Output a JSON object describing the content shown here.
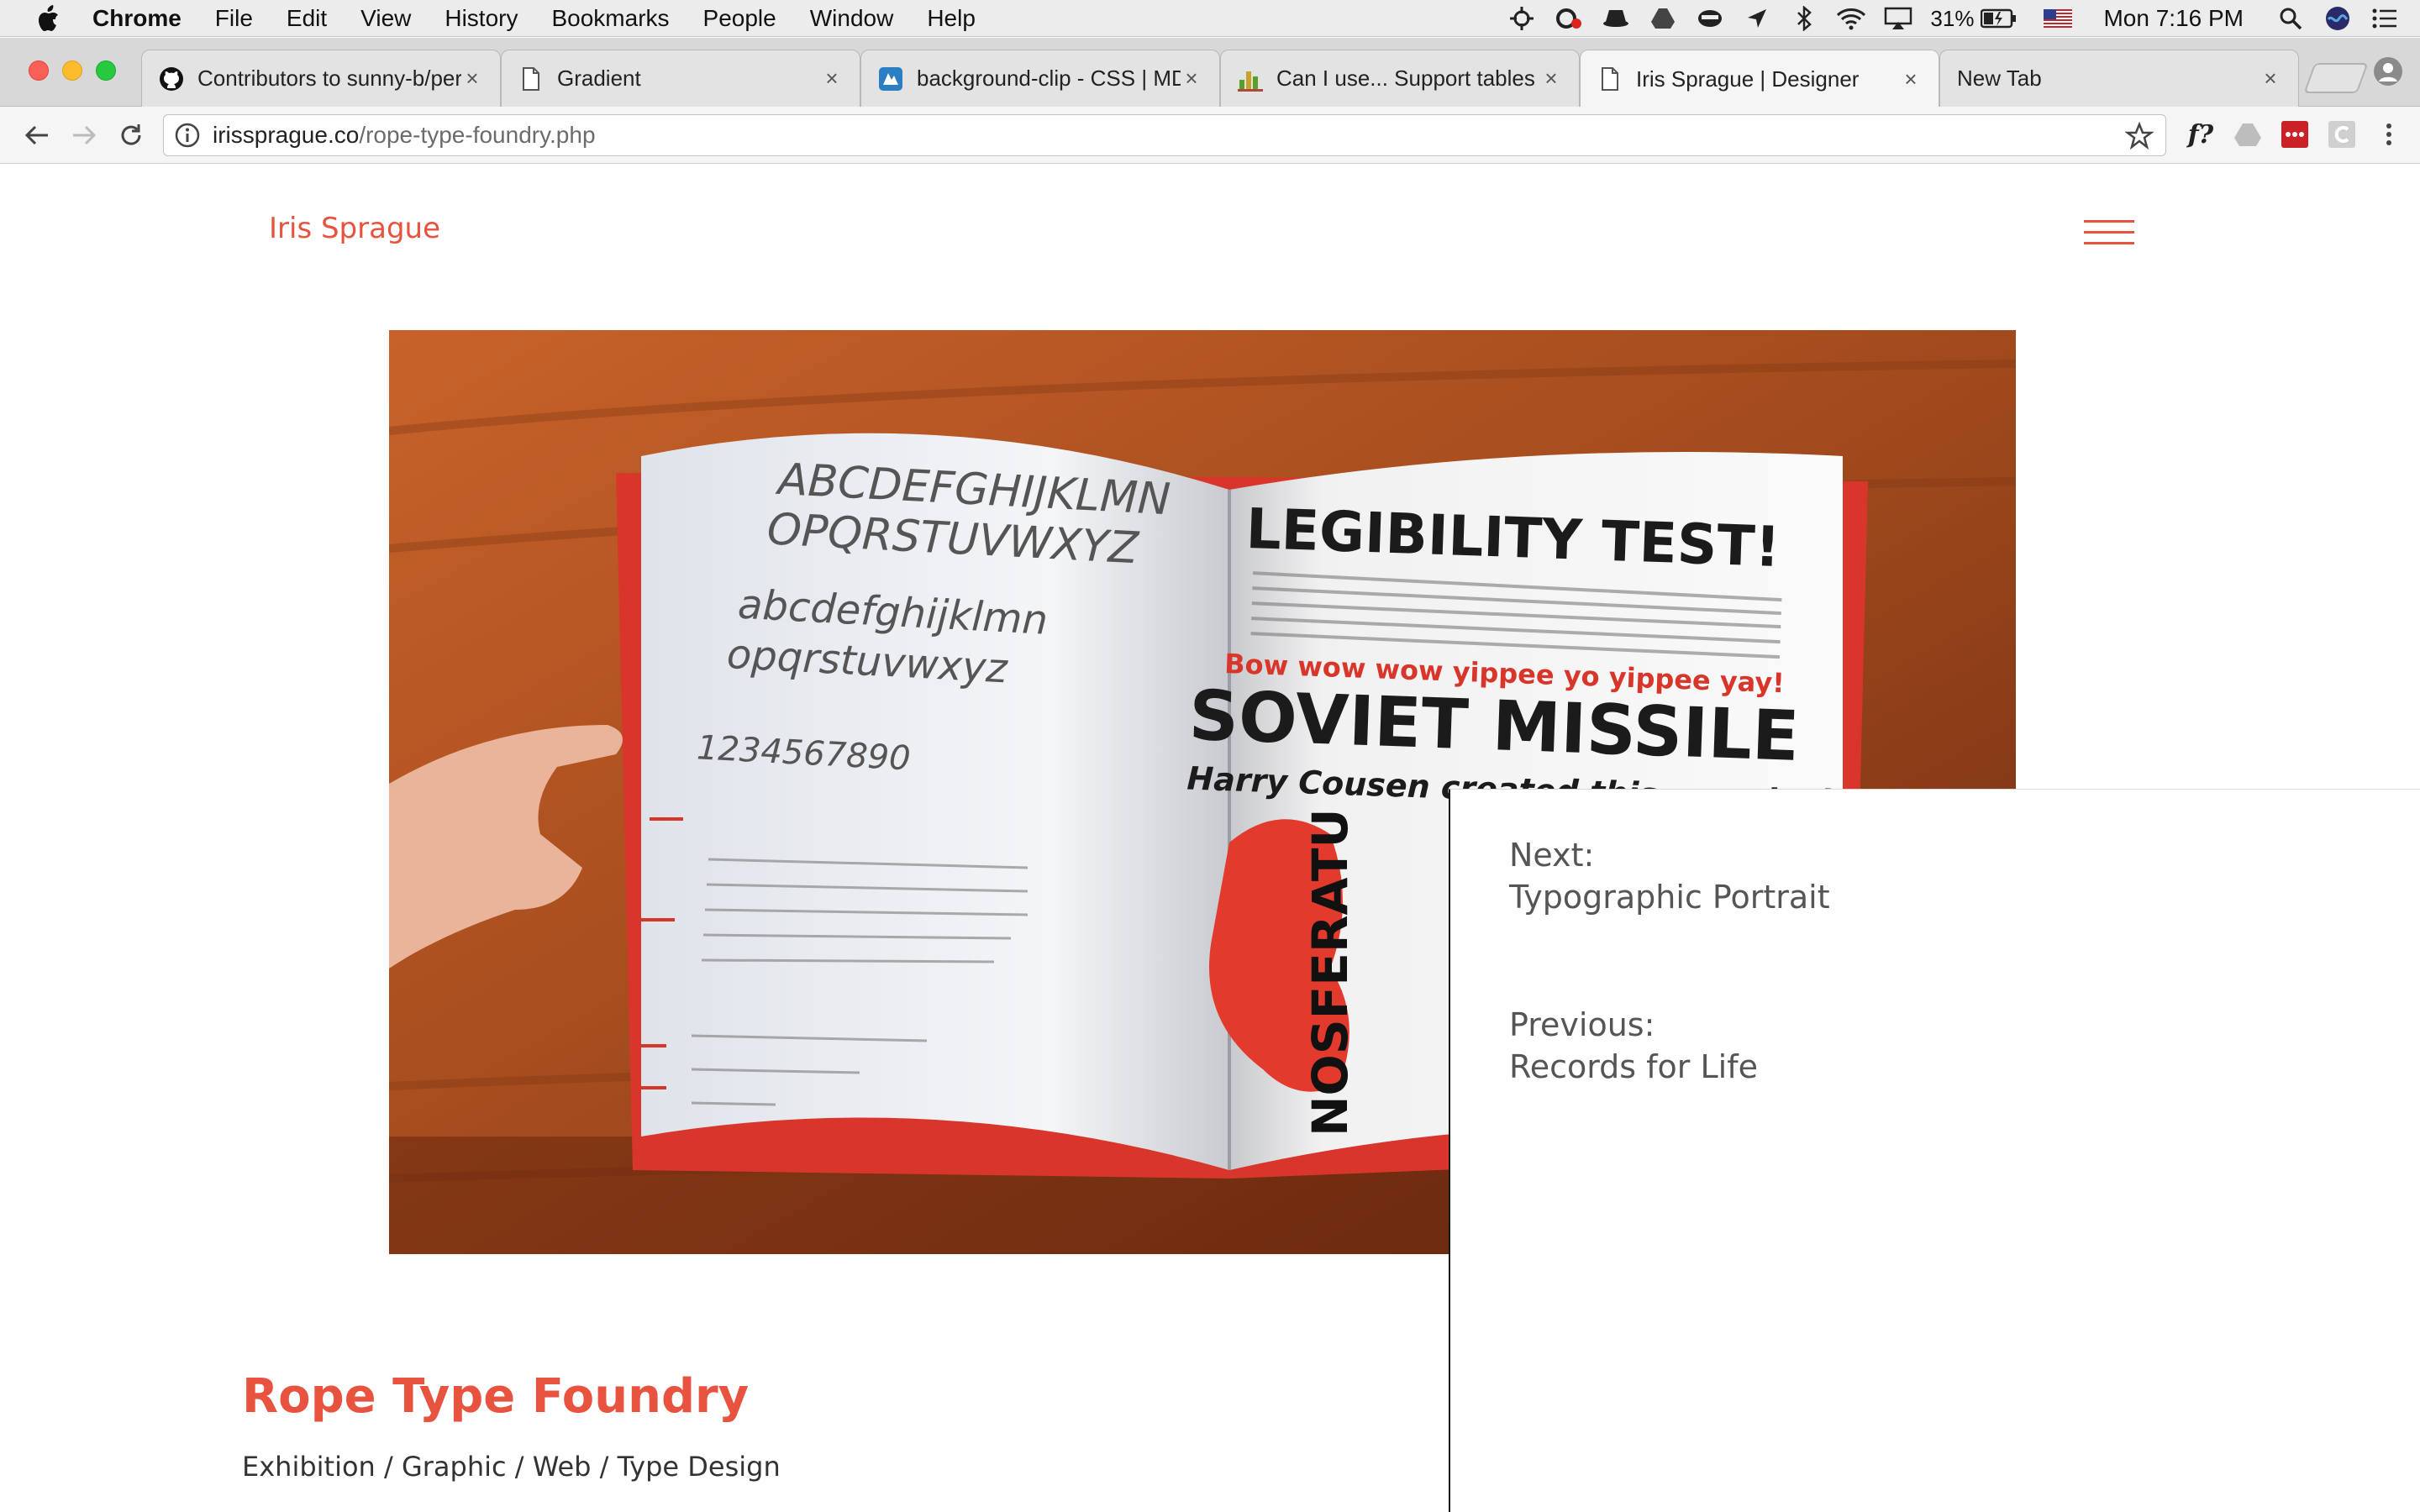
{
  "menubar": {
    "app": "Chrome",
    "items": [
      "File",
      "Edit",
      "View",
      "History",
      "Bookmarks",
      "People",
      "Window",
      "Help"
    ],
    "battery": "31%",
    "clock": "Mon 7:16 PM"
  },
  "tabs": [
    {
      "label": "Contributors to sunny-b/per",
      "icon": "github-icon"
    },
    {
      "label": "Gradient",
      "icon": "document-icon"
    },
    {
      "label": "background-clip - CSS | MD",
      "icon": "mdn-icon"
    },
    {
      "label": "Can I use... Support tables f",
      "icon": "caniuse-icon"
    },
    {
      "label": "Iris Sprague | Designer",
      "icon": "document-icon",
      "active": true
    },
    {
      "label": "New Tab",
      "icon": ""
    }
  ],
  "toolbar": {
    "url_host": "irissprague.co",
    "url_path": "/rope-type-foundry.php",
    "ext_whatfont": "f?"
  },
  "site": {
    "name": "Iris Sprague",
    "accent_color": "#e8533f"
  },
  "hero": {
    "left_spread_lines": [
      "ABCDEFGHIJKLMN",
      "OPQRSTUVWXYZ",
      "abcdefghijklmn",
      "opqrstuvwxyz",
      "1234567890"
    ],
    "right_headline_1": "LEGIBILITY TEST!",
    "right_red_line": "Bow wow wow yippee yo yippee yay!",
    "right_headline_2": "SOVIET MISSILE",
    "right_subline": "Harry Cousen created this monster!",
    "poster_text": "NOSFERATU"
  },
  "nav_panel": {
    "next_label": "Next:",
    "next_title": "Typographic Portrait",
    "prev_label": "Previous:",
    "prev_title": "Records for Life"
  },
  "project": {
    "title": "Rope Type Foundry",
    "tags": "Exhibition / Graphic / Web / Type Design"
  }
}
